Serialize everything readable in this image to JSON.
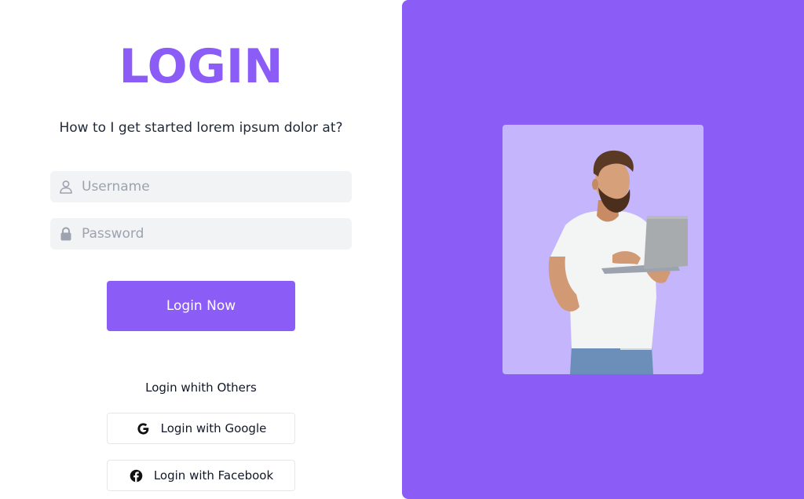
{
  "login": {
    "title": "LOGIN",
    "subtitle": "How to I get started lorem ipsum dolor at?",
    "username": {
      "placeholder": "Username",
      "value": ""
    },
    "password": {
      "placeholder": "Password",
      "value": ""
    },
    "submit_label": "Login Now",
    "others_label": "Login whith Others",
    "google_label": "Login with Google",
    "facebook_label": "Login with Facebook"
  },
  "icons": {
    "username": "user-icon",
    "password": "lock-icon",
    "google": "google-icon",
    "facebook": "facebook-icon"
  },
  "colors": {
    "accent": "#8b5cf6",
    "card_bg": "#c4b5fd",
    "input_bg": "#f2f3f5",
    "placeholder": "#9ca3af"
  },
  "hero": {
    "image": "man-with-laptop-photo"
  }
}
